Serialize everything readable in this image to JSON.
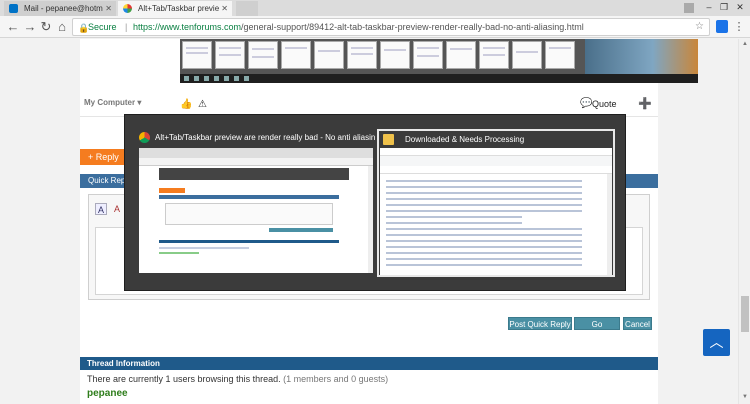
{
  "browser": {
    "tabs": [
      {
        "label": "Mail - pepanee@hotm",
        "active": false,
        "icon": "outlook-icon"
      },
      {
        "label": "Alt+Tab/Taskbar previe",
        "active": true,
        "icon": "tenforums-icon"
      }
    ],
    "address": {
      "secure_label": "Secure",
      "url_domain": "https://www.tenforums.com",
      "url_path": "/general-support/89412-alt-tab-taskbar-preview-render-really-bad-no-anti-aliasing.html"
    },
    "window_controls": [
      "minimize-icon",
      "maximize-icon",
      "close-icon"
    ]
  },
  "post": {
    "my_computer_label": "My Computer",
    "quote_label": "Quote"
  },
  "reply": {
    "reply_button": "+ Reply",
    "quick_reply_header": "Quick Reply"
  },
  "actions": {
    "post_quick_reply": "Post Quick Reply",
    "go_advanced": "Go Advanced",
    "cancel": "Cancel"
  },
  "thread_info": {
    "header": "Thread Information",
    "browsing_text": "There are currently 1 users browsing this thread.",
    "browsing_detail": "(1 members and 0 guests)",
    "user": "pepanee"
  },
  "alt_tab": {
    "windows": [
      {
        "title": "Alt+Tab/Taskbar preview are render really bad - No anti aliasin...",
        "selected": false,
        "icon": "chrome-icon"
      },
      {
        "title": "Downloaded & Needs Processing",
        "selected": true,
        "icon": "folder-icon"
      }
    ]
  },
  "colors": {
    "accent_blue": "#1f5a8a",
    "reply_orange": "#f57c1f",
    "button_teal": "#4a90a4",
    "user_green": "#2e7d1b",
    "back_to_top": "#1565c0"
  }
}
